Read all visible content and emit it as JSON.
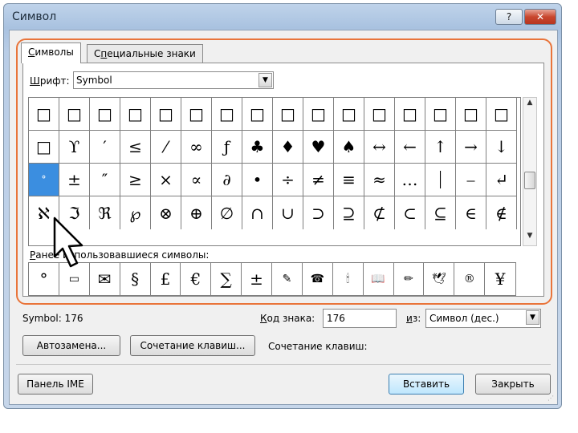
{
  "window": {
    "title": "Символ",
    "help_label": "?",
    "close_label": "✕"
  },
  "tabs": [
    {
      "label_u": "С",
      "label_rest": "имволы"
    },
    {
      "label_pre": "С",
      "label_u": "п",
      "label_rest": "ециальные знаки"
    }
  ],
  "font": {
    "label_u": "Ш",
    "label_rest": "рифт:",
    "value": "Symbol"
  },
  "symbol_grid": {
    "rows": [
      [
        "□",
        "□",
        "□",
        "□",
        "□",
        "□",
        "□",
        "□",
        "□",
        "□",
        "□",
        "□",
        "□",
        "□",
        "□",
        "□"
      ],
      [
        "□",
        "ϒ",
        "′",
        "≤",
        "⁄",
        "∞",
        "ƒ",
        "♣",
        "♦",
        "♥",
        "♠",
        "↔",
        "←",
        "↑",
        "→",
        "↓"
      ],
      [
        "°",
        "±",
        "″",
        "≥",
        "×",
        "∝",
        "∂",
        "•",
        "÷",
        "≠",
        "≡",
        "≈",
        "…",
        "⏐",
        "⎯",
        "↵"
      ],
      [
        "ℵ",
        "ℑ",
        "ℜ",
        "℘",
        "⊗",
        "⊕",
        "∅",
        "∩",
        "∪",
        "⊃",
        "⊇",
        "⊄",
        "⊂",
        "⊆",
        "∈",
        "∉"
      ]
    ],
    "selected": "°"
  },
  "recent": {
    "label_u": "Р",
    "label_rest": "анее использовавшиеся символы:",
    "symbols": [
      "°",
      "▭",
      "✉",
      "§",
      "£",
      "€",
      "∑",
      "±",
      "✎",
      "☎",
      "🕯",
      "📖",
      "✏",
      "🕊",
      "®",
      "¥"
    ]
  },
  "status": {
    "symbol_info": "Symbol: 176",
    "code_label_u": "К",
    "code_label_rest": "од знака:",
    "code_value": "176",
    "from_label_u": "и",
    "from_label_rest": "з:",
    "from_value": "Символ (дес.)"
  },
  "buttons": {
    "autocorrect": "Автозамена...",
    "autocorrect_u": "А",
    "shortcut": "Сочетание клавиш...",
    "shortcut_u": "ч",
    "shortcut_text": "Сочетание клавиш:",
    "ime": "Панель IME",
    "insert": "Вставить",
    "close": "Закрыть"
  },
  "colors": {
    "accent_highlight": "#e9743a",
    "selection": "#3b8ee0"
  }
}
